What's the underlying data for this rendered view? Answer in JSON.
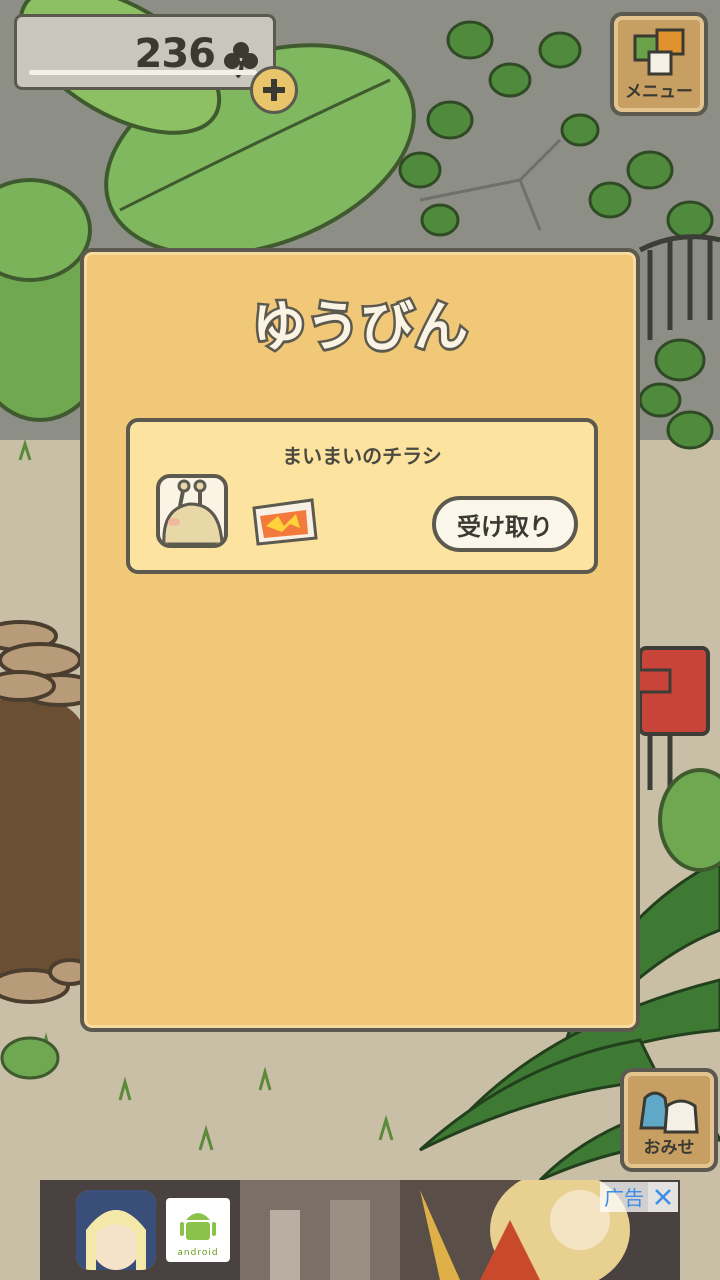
{
  "hud": {
    "clover_count": "236",
    "clover_icon": "clover-icon",
    "add_icon": "plus-icon"
  },
  "menu_button": {
    "label": "メニュー",
    "icon": "menu-squares-icon"
  },
  "shop_button": {
    "label": "おみせ",
    "icon": "shop-bags-icon"
  },
  "mail_dialog": {
    "title": "ゆうびん",
    "items": [
      {
        "sender": "まいまいのチラシ",
        "avatar_icon": "snail-avatar-icon",
        "attachment_icon": "flyer-icon",
        "receive_label": "受け取り"
      }
    ]
  },
  "ad_banner": {
    "label": "广告",
    "close_icon": "close-icon",
    "badge_text": "android",
    "app_icon": "game-app-icon"
  },
  "colors": {
    "dialog_bg": "#f0c878",
    "item_bg": "#fde3a0",
    "outline": "#5c5a4e",
    "foliage": "#6aa24a"
  }
}
